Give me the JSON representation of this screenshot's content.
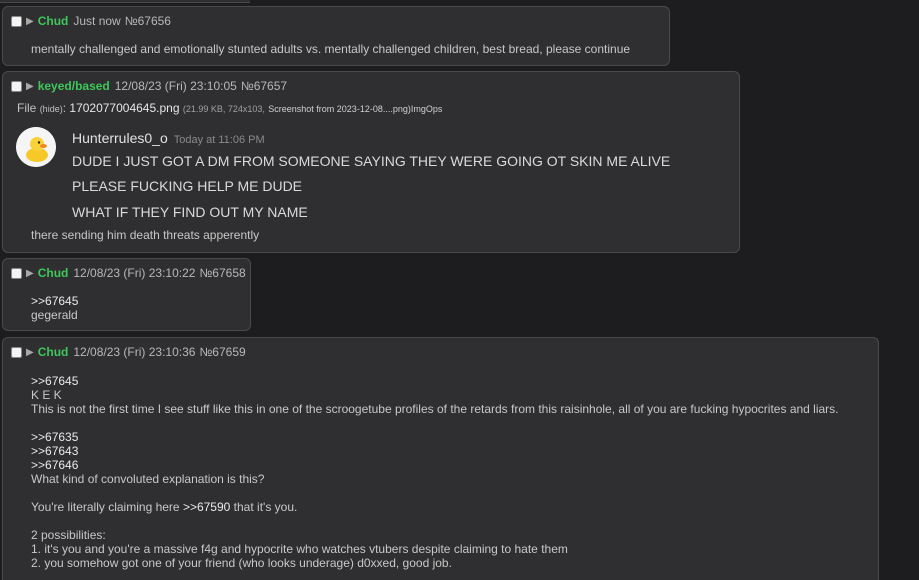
{
  "posts": [
    {
      "name": "Chud",
      "date": "Just now",
      "number": "№67656",
      "lines": [
        "mentally challenged and emotionally stunted adults vs. mentally challenged children, best bread, please continue"
      ]
    },
    {
      "name": "keyed/based",
      "date": "12/08/23 (Fri) 23:10:05",
      "number": "№67657",
      "file": {
        "prefix": "File",
        "hide": "(hide)",
        "colon": ":",
        "filename": "1702077004645.png",
        "meta": "(21.99 KB, 724x103,",
        "original": "Screenshot from 2023-12-08....png)",
        "imgops": "ImgOps"
      },
      "embed": {
        "username": "Hunterrules0_o",
        "timestamp": "Today at 11:06 PM",
        "messages": [
          "DUDE I JUST GOT A DM FROM SOMEONE SAYING THEY WERE GOING OT SKIN ME ALIVE",
          "PLEASE FUCKING HELP ME DUDE",
          "WHAT IF THEY FIND OUT MY NAME"
        ]
      },
      "lines": [
        "there sending him death threats apperently"
      ]
    },
    {
      "name": "Chud",
      "date": "12/08/23 (Fri) 23:10:22",
      "number": "№67658",
      "reply": ">>67645",
      "lines": [
        "gegerald"
      ]
    },
    {
      "name": "Chud",
      "date": "12/08/23 (Fri) 23:10:36",
      "number": "№67659",
      "reply1": ">>67645",
      "kek": "K E K",
      "line1": "This is not the first time I see stuff like this in one of the scroogetube profiles of the retards from this raisinhole, all of you are fucking hypocrites and liars.",
      "replies2": [
        ">>67635",
        ">>67643",
        ">>67646"
      ],
      "line2": "What kind of convoluted explanation is this?",
      "claim_pre": "You're literally claiming here",
      "claim_ref": ">>67590",
      "claim_post": "that it's you.",
      "possibilities": "2 possibilities:",
      "p1": "1. it's you and you're a massive f4g and hypocrite who watches vtubers despite claiming to hate them",
      "p2": "2. you somehow got one of your friend (who looks underage) d0xxed, good job."
    }
  ],
  "colors": {
    "name": "#3ec85a",
    "background": "#1d1d1f",
    "post": "#2f2f31"
  }
}
